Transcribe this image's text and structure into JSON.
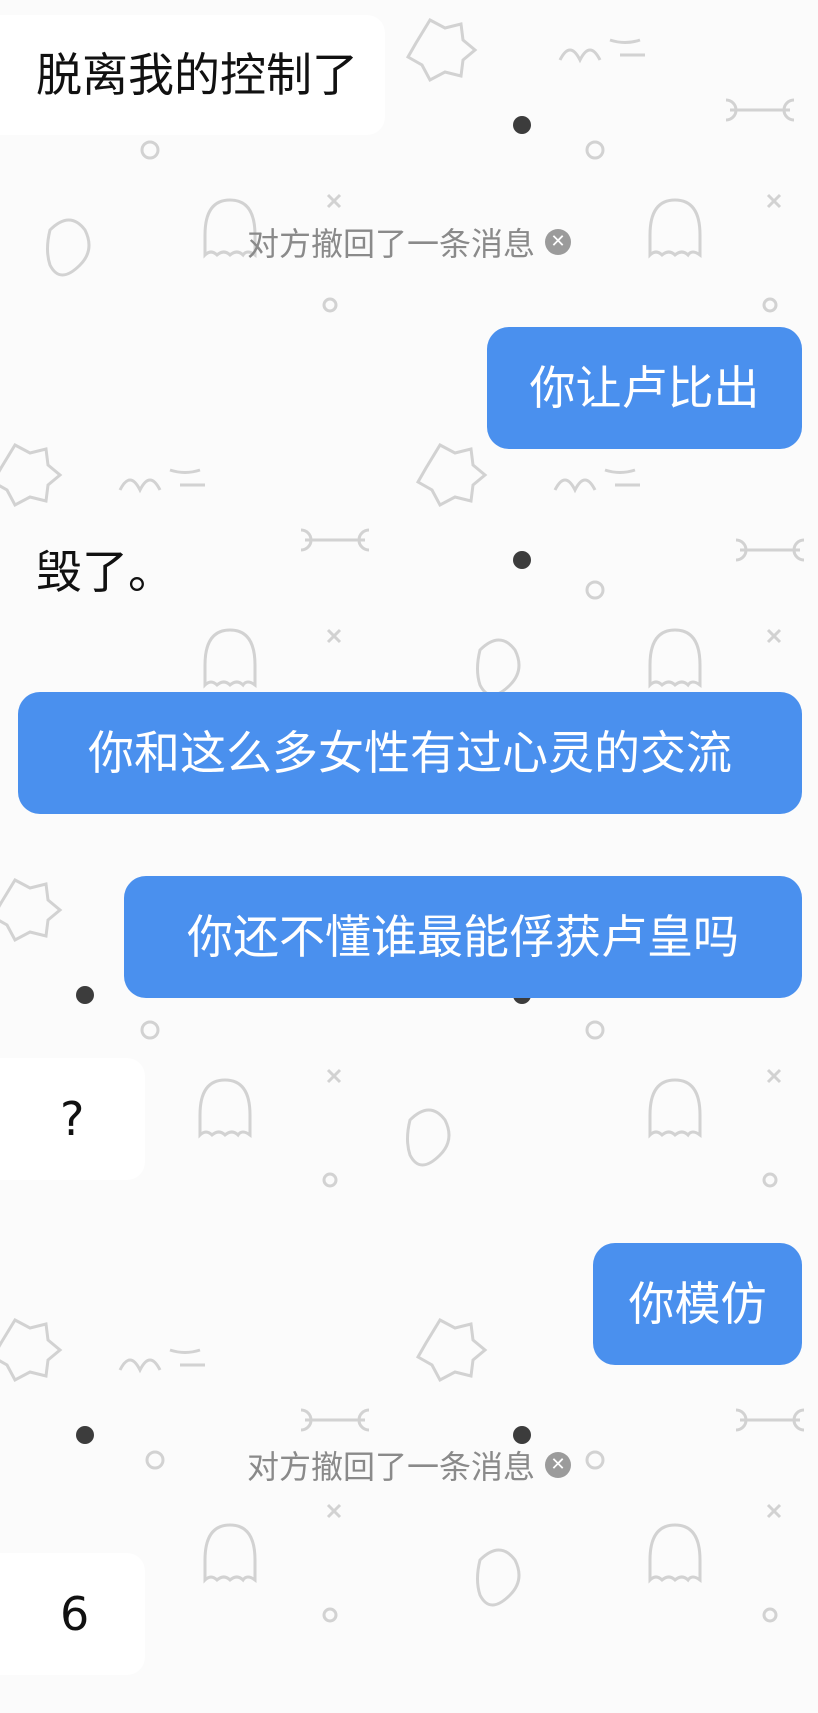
{
  "chat": {
    "messages": [
      {
        "side": "received",
        "text": "脱离我的控制了"
      },
      {
        "side": "system",
        "text": "对方撤回了一条消息",
        "icon": "close-circle-icon"
      },
      {
        "side": "sent",
        "text": "你让卢比出"
      },
      {
        "side": "received",
        "text": "毁了。"
      },
      {
        "side": "sent",
        "text": "你和这么多女性有过心灵的交流"
      },
      {
        "side": "sent",
        "text": "你还不懂谁最能俘获卢皇吗"
      },
      {
        "side": "received",
        "text": "?"
      },
      {
        "side": "sent",
        "text": "你模仿"
      },
      {
        "side": "system",
        "text": "对方撤回了一条消息",
        "icon": "close-circle-icon"
      },
      {
        "side": "received",
        "text": "6"
      }
    ]
  },
  "colors": {
    "sent_bubble": "#4a90ee",
    "received_bubble": "#ffffff",
    "background": "#fbfbfb",
    "recall_text": "#8a8a8a"
  }
}
